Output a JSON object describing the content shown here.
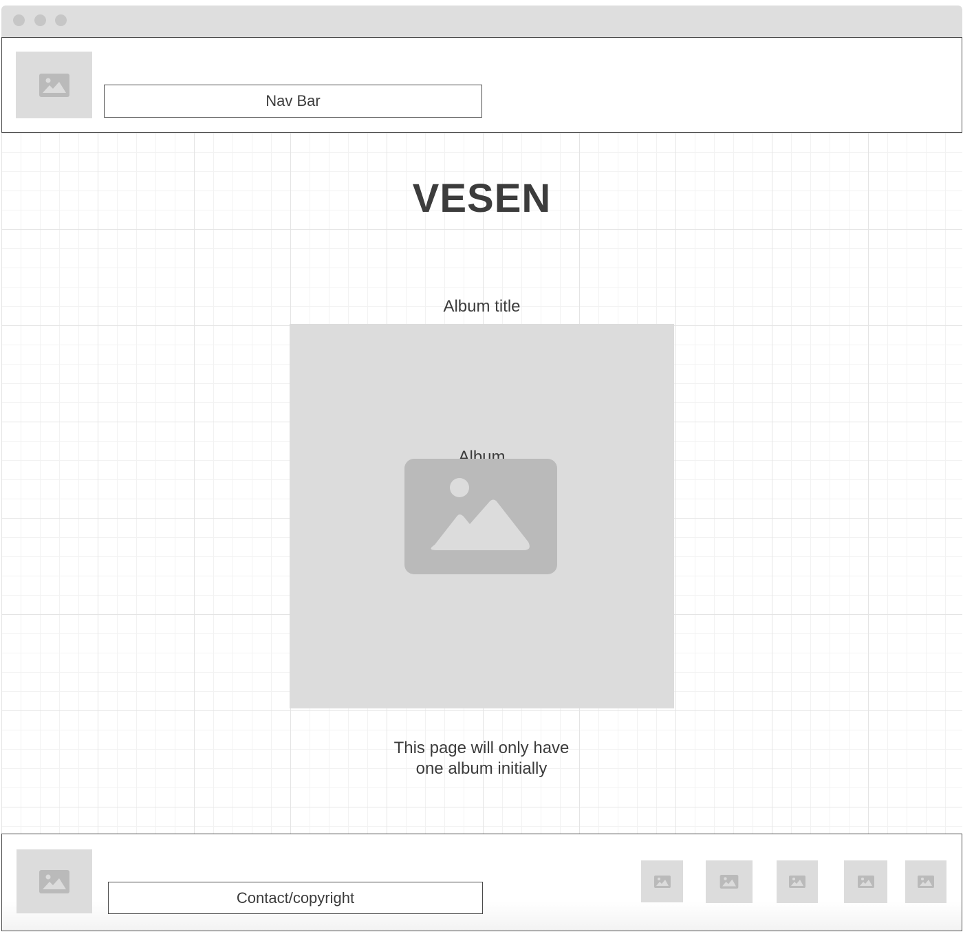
{
  "header": {
    "logo_icon": "image-placeholder-icon",
    "nav_label": "Nav Bar"
  },
  "main": {
    "site_title": "VESEN",
    "album_title": "Album title",
    "album_label": "Album",
    "album_icon": "image-placeholder-icon",
    "note": "This page will only have one album initially"
  },
  "footer": {
    "logo_icon": "image-placeholder-icon",
    "contact_label": "Contact/copyright",
    "social_icons": [
      "image-placeholder-icon",
      "image-placeholder-icon",
      "image-placeholder-icon",
      "image-placeholder-icon",
      "image-placeholder-icon"
    ]
  },
  "colors": {
    "placeholder_bg": "#dcdcdc",
    "placeholder_icon": "#bababa",
    "text": "#3c3c3c",
    "border": "#4a4a4a",
    "chrome": "#dedede"
  }
}
